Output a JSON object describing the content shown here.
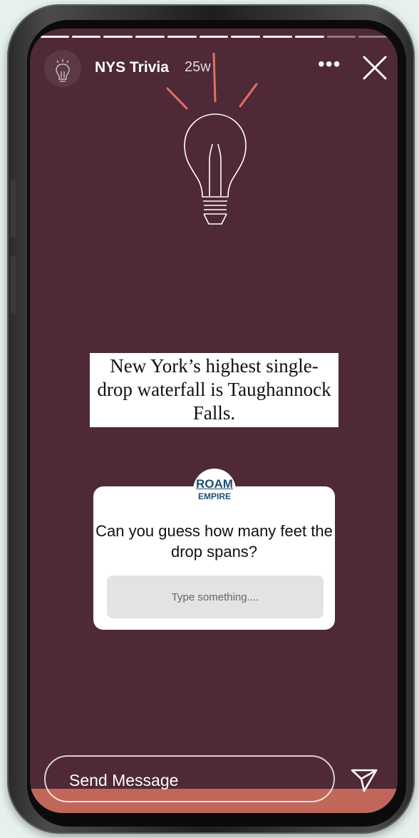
{
  "story": {
    "account_name": "NYS Trivia",
    "age": "25w",
    "more_icon": "more-dots-icon",
    "close_icon": "close-icon",
    "progress": {
      "total_segments": 11,
      "current_segment": 9
    }
  },
  "fact_text": "New York’s highest single-drop waterfall is Taughannock Falls.",
  "question_sticker": {
    "logo_line1": "ROAM",
    "logo_line2": "EMPIRE",
    "question": "Can you guess how many feet the drop spans?",
    "input_placeholder": "Type something...."
  },
  "footer": {
    "message_placeholder": "Send Message",
    "send_icon": "paper-plane-icon"
  },
  "colors": {
    "background": "#4f2937",
    "bulb_rays": "#e07063",
    "accent_bar": "#c1675a",
    "logo": "#1f4f74"
  }
}
